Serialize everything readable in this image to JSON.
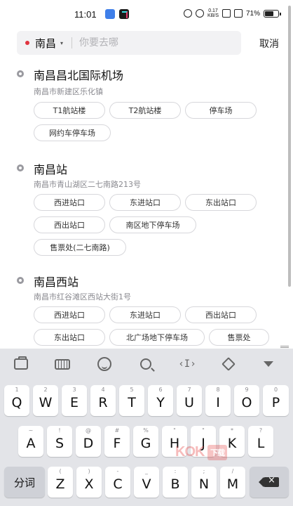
{
  "status_bar": {
    "time": "11:01",
    "speed": "0.17\nKB/S",
    "battery_text": "71%",
    "battery_level": 0.71
  },
  "search": {
    "city": "南昌",
    "placeholder": "你要去哪",
    "cancel_label": "取消"
  },
  "results": [
    {
      "title": "南昌昌北国际机场",
      "address": "南昌市新建区乐化镇",
      "chips": [
        "T1航站楼",
        "T2航站楼",
        "停车场",
        "网约车停车场"
      ]
    },
    {
      "title": "南昌站",
      "address": "南昌市青山湖区二七南路213号",
      "chips": [
        "西进站口",
        "东进站口",
        "东出站口",
        "西出站口",
        "南区地下停车场",
        "售票处(二七南路)"
      ]
    },
    {
      "title": "南昌西站",
      "address": "南昌市红谷滩区西站大街1号",
      "chips": [
        "西进站口",
        "东进站口",
        "西出站口",
        "东出站口",
        "北广场地下停车场",
        "售票处"
      ]
    }
  ],
  "keyboard": {
    "toolbar_icons": [
      "toolbox-icon",
      "keyboard-icon",
      "emoji-icon",
      "search-icon",
      "cursor-icon",
      "eraser-icon",
      "collapse-icon"
    ],
    "row1": [
      {
        "key": "Q",
        "hint": "1"
      },
      {
        "key": "W",
        "hint": "2"
      },
      {
        "key": "E",
        "hint": "3"
      },
      {
        "key": "R",
        "hint": "4"
      },
      {
        "key": "T",
        "hint": "5"
      },
      {
        "key": "Y",
        "hint": "6"
      },
      {
        "key": "U",
        "hint": "7"
      },
      {
        "key": "I",
        "hint": "8"
      },
      {
        "key": "O",
        "hint": "9"
      },
      {
        "key": "P",
        "hint": "0"
      }
    ],
    "row2": [
      {
        "key": "A",
        "hint": "~"
      },
      {
        "key": "S",
        "hint": "!"
      },
      {
        "key": "D",
        "hint": "@"
      },
      {
        "key": "F",
        "hint": "#"
      },
      {
        "key": "G",
        "hint": "%"
      },
      {
        "key": "H",
        "hint": "\""
      },
      {
        "key": "J",
        "hint": "\""
      },
      {
        "key": "K",
        "hint": "*"
      },
      {
        "key": "L",
        "hint": "?"
      }
    ],
    "row3": [
      {
        "key": "Z",
        "hint": "("
      },
      {
        "key": "X",
        "hint": ")"
      },
      {
        "key": "C",
        "hint": "-"
      },
      {
        "key": "V",
        "hint": "_"
      },
      {
        "key": "B",
        "hint": ":"
      },
      {
        "key": "N",
        "hint": ";"
      },
      {
        "key": "M",
        "hint": "/"
      }
    ],
    "fenci_label": "分词"
  },
  "watermark": {
    "text": "KOK",
    "box": "下载"
  }
}
